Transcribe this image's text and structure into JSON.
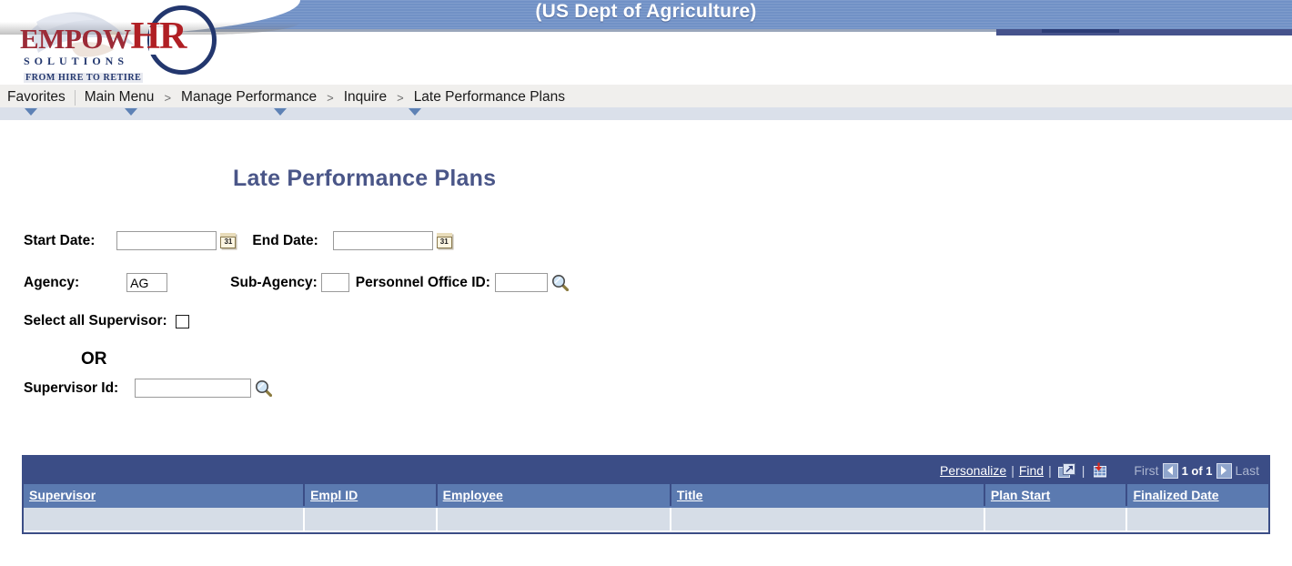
{
  "banner": {
    "agency_title": "(US Dept of Agriculture)",
    "logo": {
      "empow": "EMPOW",
      "hr": "HR",
      "solutions": "SOLUTIONS",
      "tagline": "FROM HIRE TO RETIRE"
    }
  },
  "breadcrumb": {
    "items": [
      {
        "label": "Favorites",
        "has_dropdown": true
      },
      {
        "label": "Main Menu",
        "has_dropdown": true
      },
      {
        "label": "Manage Performance",
        "has_dropdown": true
      },
      {
        "label": "Inquire",
        "has_dropdown": true
      },
      {
        "label": "Late Performance Plans",
        "has_dropdown": false
      }
    ],
    "separator": ">"
  },
  "page": {
    "title": "Late Performance Plans"
  },
  "form": {
    "start_date": {
      "label": "Start Date:",
      "value": "",
      "calendar_icon_day": "31"
    },
    "end_date": {
      "label": "End Date:",
      "value": "",
      "calendar_icon_day": "31"
    },
    "agency": {
      "label": "Agency:",
      "value": "AG"
    },
    "sub_agency": {
      "label": "Sub-Agency:",
      "value": ""
    },
    "personnel_office_id": {
      "label": "Personnel Office ID:",
      "value": ""
    },
    "select_all_supervisor": {
      "label": "Select all Supervisor:",
      "checked": false
    },
    "or_label": "OR",
    "supervisor_id": {
      "label": "Supervisor Id:",
      "value": ""
    }
  },
  "grid": {
    "toolbar": {
      "personalize": "Personalize",
      "find": "Find",
      "sep": "|",
      "view_all_icon": "expand-icon",
      "download_icon": "download-spreadsheet-icon",
      "first": "First",
      "page_count": "1 of 1",
      "last": "Last"
    },
    "columns": [
      "Supervisor",
      "Empl ID",
      "Employee",
      "Title",
      "Plan Start",
      "Finalized Date"
    ],
    "rows": [
      {
        "supervisor": "",
        "empl_id": "",
        "employee": "",
        "title": "",
        "plan_start": "",
        "finalized_date": ""
      }
    ]
  },
  "colors": {
    "banner_blue": "#7191c6",
    "title_navy": "#4a5688",
    "grid_toolbar": "#3b4d86",
    "grid_header": "#5b7ab0",
    "grid_cell": "#d6dde7"
  }
}
